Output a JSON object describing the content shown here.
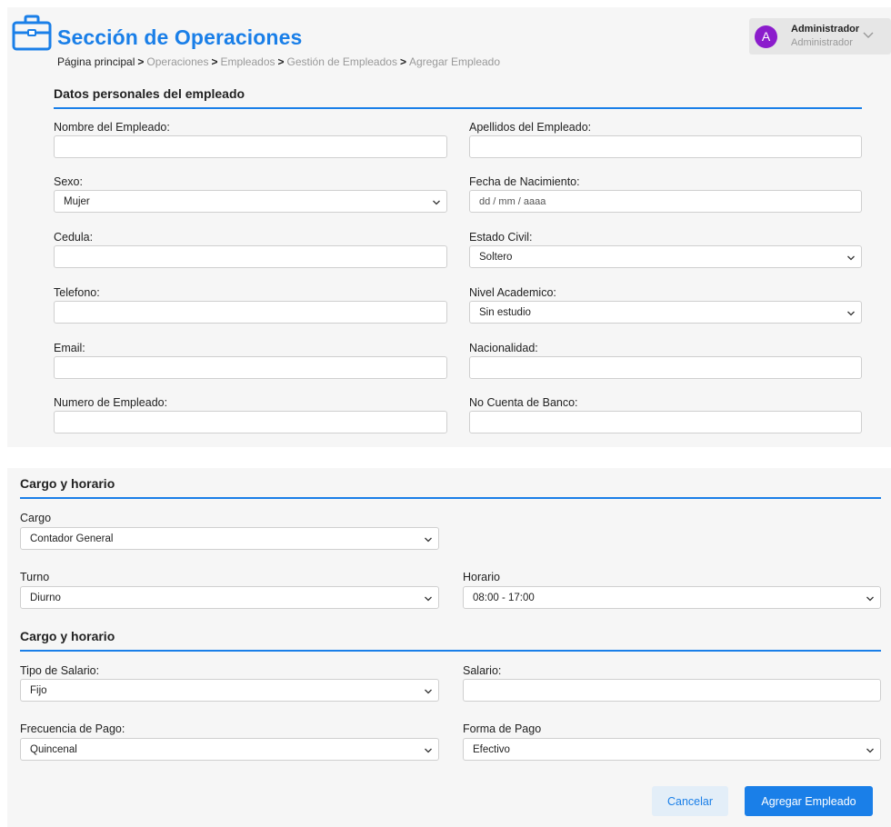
{
  "header": {
    "title": "Sección de Operaciones",
    "breadcrumb": {
      "home": "Página principal",
      "items": [
        "Operaciones",
        "Empleados",
        "Gestión de Empleados",
        "Agregar Empleado"
      ],
      "separator": ">"
    },
    "user": {
      "initial": "A",
      "name": "Administrador",
      "role": "Administrador"
    }
  },
  "personal": {
    "title": "Datos personales del empleado",
    "nombre_label": "Nombre del Empleado:",
    "apellidos_label": "Apellidos del Empleado:",
    "sexo_label": "Sexo:",
    "sexo_value": "Mujer",
    "fecha_label": "Fecha de Nacimiento:",
    "fecha_placeholder": "dd / mm / aaaa",
    "cedula_label": "Cedula:",
    "estado_civil_label": "Estado Civil:",
    "estado_civil_value": "Soltero",
    "telefono_label": "Telefono:",
    "nivel_label": "Nivel Academico:",
    "nivel_value": "Sin estudio",
    "email_label": "Email:",
    "nacionalidad_label": "Nacionalidad:",
    "numero_label": "Numero de Empleado:",
    "cuenta_label": "No Cuenta de Banco:"
  },
  "cargo": {
    "title": "Cargo y horario",
    "cargo_label": "Cargo",
    "cargo_value": "Contador General",
    "turno_label": "Turno",
    "turno_value": "Diurno",
    "horario_label": "Horario",
    "horario_value": "08:00 - 17:00"
  },
  "salario": {
    "title": "Cargo y horario",
    "tipo_label": "Tipo de Salario:",
    "tipo_value": "Fijo",
    "salario_label": "Salario:",
    "frecuencia_label": "Frecuencia de Pago:",
    "frecuencia_value": "Quincenal",
    "forma_label": "Forma de Pago",
    "forma_value": "Efectivo"
  },
  "actions": {
    "cancel": "Cancelar",
    "submit": "Agregar Empleado"
  },
  "colors": {
    "accent": "#1a7fe8",
    "avatar": "#8b1ccc",
    "panel": "#f6f6f6"
  },
  "icons": {
    "brand": "briefcase-icon",
    "dropdown": "chevron-down-icon"
  }
}
